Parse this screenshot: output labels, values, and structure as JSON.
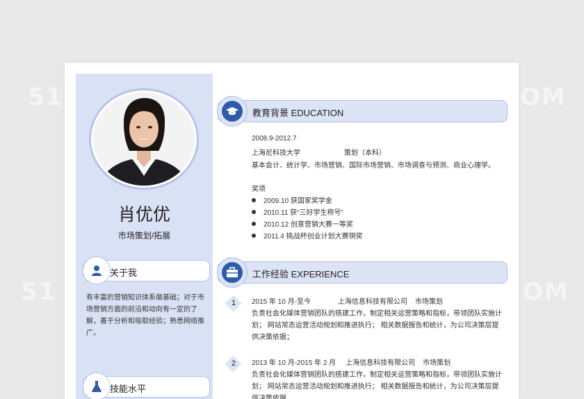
{
  "profile": {
    "name": "肖优优",
    "role": "市场策划/拓展"
  },
  "sidebar": {
    "about_title": "关于我",
    "about_text": "有丰富的营销知识体系做基础；对于市场营销方面的前沿和动向有一定的了解，善于分析和吸取经验；熟悉网络推广。",
    "skills_title": "技能水平"
  },
  "education": {
    "title": "教育背景 EDUCATION",
    "period": "2008.9-2012.7",
    "school": "上海尼科技大学",
    "major": "策划（本科）",
    "courses": "基本会计、统计学、市场营销、国际市场营销、市场调查与预测、商业心理学。",
    "awards_title": "奖项",
    "awards": [
      "2009.10 获国家奖学金",
      "2010.11 获“三好学生称号”",
      "2010.12 创意营销大赛一等奖",
      "2011.4 挑战杯创业计划大赛铜奖"
    ]
  },
  "experience": {
    "title": "工作经验 EXPERIENCE",
    "jobs": [
      {
        "num": "1",
        "header": "2015 年 10 月-至今              上海信息科技有限公司    市场策划",
        "desc": "负责社会化媒体营销团队的搭建工作，制定相关运营策略和指标，带领团队实施计划；  网站常态运营活动规划和推进执行；  相关数据报告和统计，为公司决策层提供决策依据；"
      },
      {
        "num": "2",
        "header": "2013 年 10 月-2015 年 2 月     上海信息科技有限公司    市场策划",
        "desc": "负责社会化媒体营销团队的搭建工作，制定相关运营策略和指标，带领团队实施计划；  网站常态运营活动规划和推进执行；  相关数据报告和统计，为公司决策层提供决策依据"
      }
    ]
  },
  "icons": {
    "education": "graduation-cap-icon",
    "experience": "briefcase-icon",
    "about": "user-icon",
    "skills": "flask-icon"
  },
  "colors": {
    "accent": "#2f5ba8",
    "sidebar_bg": "#d9e1f4",
    "pill_bg": "#dde4f6",
    "border": "#aebde6"
  }
}
